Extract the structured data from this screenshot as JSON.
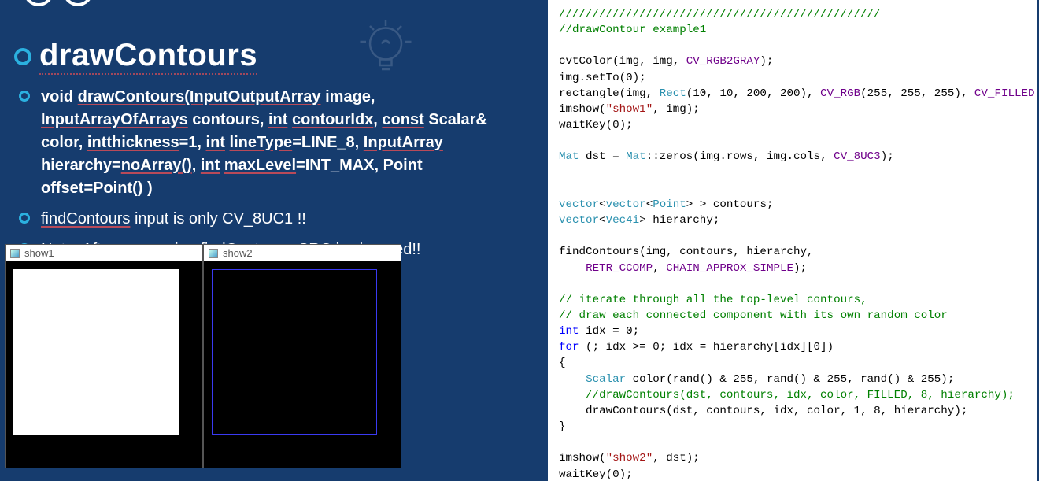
{
  "title": "drawContours",
  "signature_html": "void <span class='u'>drawContours(InputOutputArray</span> image, <span class='u'>InputArrayOfArrays</span> contours, <span class='u'>int</span> <span class='u'>contourIdx</span>, <span class='u'>const</span> Scalar&amp; color, <span class='u'>intthickness</span>=1, <span class='u'>int</span> <span class='u'>lineType</span>=LINE_8, <span class='u'>InputArray</span> hierarchy=<span class='u'>noArray()</span>, <span class='u'>int</span> <span class='u'>maxLevel</span>=INT_MAX, Point offset=Point() )",
  "bullet2_html": "<span class='u'>findContours</span> input is only CV_8UC1 !!",
  "bullet3_html": "Note, After processing <span class='u'>findContours</span>, SRC is changed!!",
  "windows": {
    "show1": "show1",
    "show2": "show2"
  },
  "code_html": "<span class='c-green'>////////////////////////////////////////////////</span>\n<span class='c-green'>//drawContour example1</span>\n\ncvtColor(img, img, <span class='c-mac'>CV_RGB2GRAY</span>);\nimg.setTo(0);\nrectangle(img, <span class='c-type'>Rect</span>(10, 10, 200, 200), <span class='c-mac'>CV_RGB</span>(255, 255, 255), <span class='c-mac'>CV_FILLED</span> );\nimshow(<span class='c-str'>\"show1\"</span>, img);\nwaitKey(0);\n\n<span class='c-type'>Mat</span> dst = <span class='c-type'>Mat</span>::zeros(img.rows, img.cols, <span class='c-mac'>CV_8UC3</span>);\n\n\n<span class='c-type'>vector</span>&lt;<span class='c-type'>vector</span>&lt;<span class='c-type'>Point</span>&gt; &gt; contours;\n<span class='c-type'>vector</span>&lt;<span class='c-type'>Vec4i</span>&gt; hierarchy;\n\nfindContours(img, contours, hierarchy,\n    <span class='c-mac'>RETR_CCOMP</span>, <span class='c-mac'>CHAIN_APPROX_SIMPLE</span>);\n\n<span class='c-green'>// iterate through all the top-level contours,</span>\n<span class='c-green'>// draw each connected component with its own random color</span>\n<span class='c-blue'>int</span> idx = 0;\n<span class='c-blue'>for</span> (; idx &gt;= 0; idx = hierarchy[idx][0])\n{\n    <span class='c-type'>Scalar</span> color(rand() &amp; 255, rand() &amp; 255, rand() &amp; 255);\n    <span class='c-green'>//drawContours(dst, contours, idx, color, FILLED, 8, hierarchy);</span>\n    drawContours(dst, contours, idx, color, 1, 8, hierarchy);\n}\n\nimshow(<span class='c-str'>\"show2\"</span>, dst);\nwaitKey(0);"
}
